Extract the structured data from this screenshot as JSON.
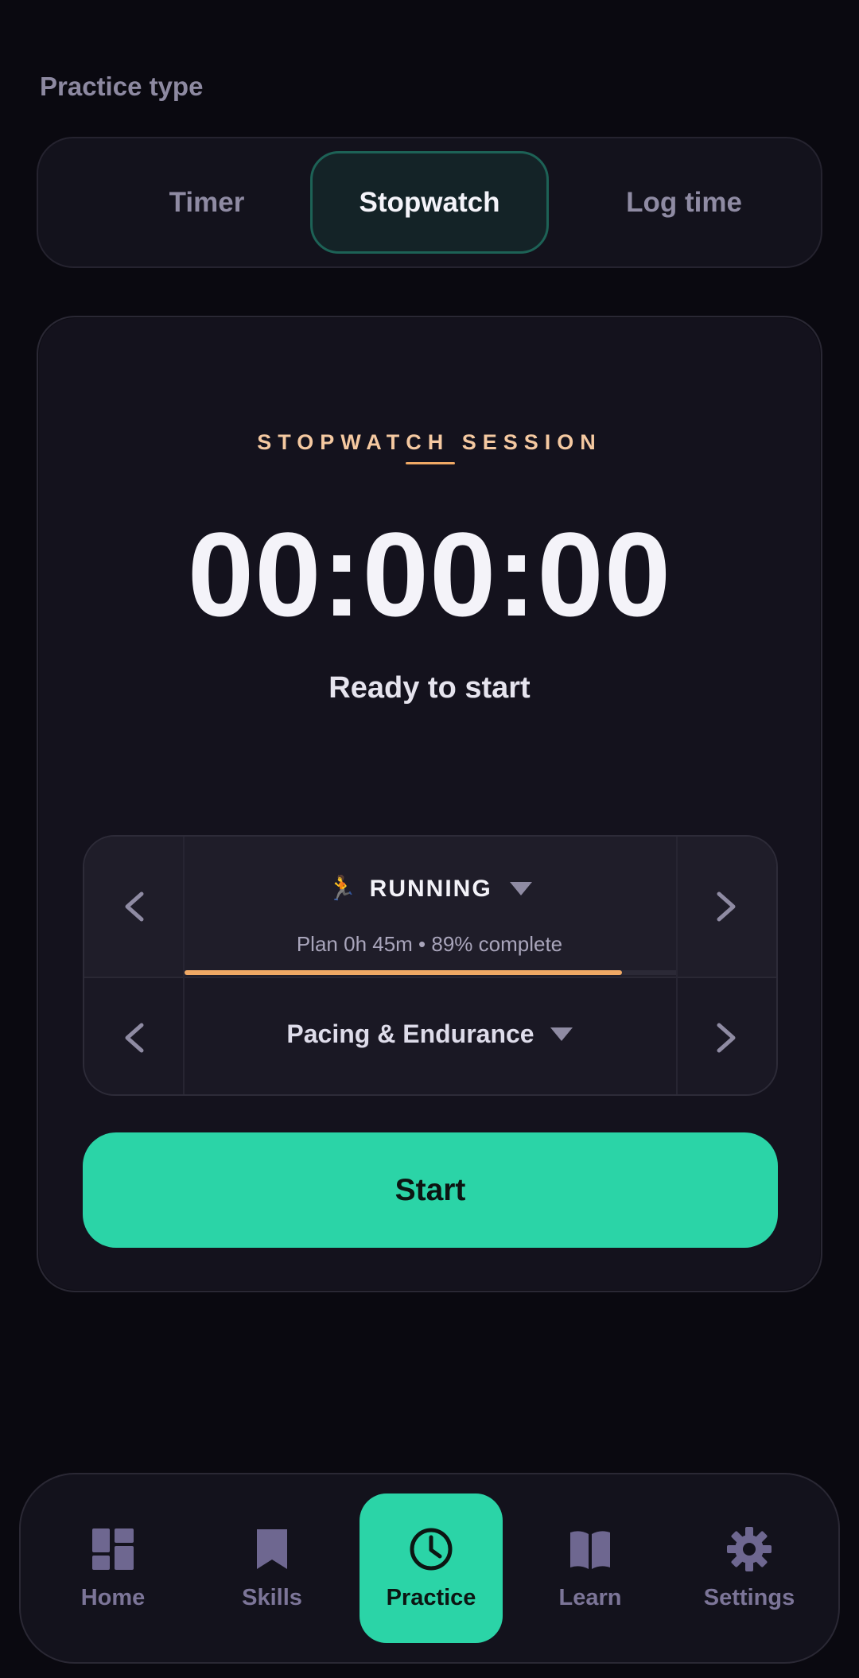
{
  "practice_type": {
    "label": "Practice type",
    "options": [
      "Timer",
      "Stopwatch",
      "Log time"
    ],
    "selected": "Stopwatch"
  },
  "session": {
    "label": "STOPWATCH SESSION",
    "clock": "00:00:00",
    "status": "Ready to start"
  },
  "selector": {
    "activity_emoji": "🏃",
    "activity": "RUNNING",
    "plan": "Plan 0h 45m • 89% complete",
    "progress_percent": 89,
    "skill": "Pacing & Endurance"
  },
  "start_label": "Start",
  "nav": {
    "items": [
      "Home",
      "Skills",
      "Practice",
      "Learn",
      "Settings"
    ],
    "active": "Practice"
  },
  "colors": {
    "accent": "#2bd4a7",
    "progress": "#f0a965",
    "session_label": "#f5c9a1"
  }
}
